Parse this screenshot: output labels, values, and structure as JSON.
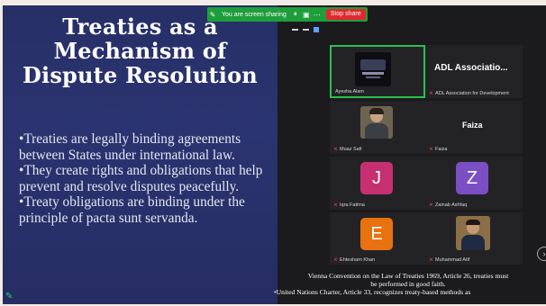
{
  "slide": {
    "title_lines": [
      "Treaties as a",
      "Mechanism of",
      "Dispute Resolution"
    ],
    "bullets": [
      "•Treaties are legally binding agreements between States under international law.",
      "•They create rights and obligations that help prevent and resolve disputes peacefully.",
      "•Treaty obligations are binding under the principle of pacta sunt servanda."
    ]
  },
  "share_bar": {
    "status_text": "You are screen sharing",
    "stop_label": "Stop share"
  },
  "participants": [
    {
      "tile_name": "Ayesha Alam",
      "kind": "video"
    },
    {
      "tile_name": "ADL Association for Development",
      "big_label": "ADL Associatio...",
      "kind": "name"
    },
    {
      "tile_name": "Muaz Safi",
      "kind": "video"
    },
    {
      "tile_name": "Faiza",
      "big_label": "Faiza",
      "kind": "name"
    },
    {
      "tile_name": "Iqra Fatima",
      "initial": "J",
      "color": "#c63071",
      "kind": "avatar"
    },
    {
      "tile_name": "Zainab Ashfaq",
      "initial": "Z",
      "color": "#7b4fc4",
      "kind": "avatar"
    },
    {
      "tile_name": "Ehtesham Khan",
      "initial": "E",
      "color": "#e8720f",
      "kind": "avatar"
    },
    {
      "tile_name": "Muhammad Atif",
      "kind": "video"
    }
  ],
  "caption": {
    "line1": "Vienna Convention on the Law of Treaties 1969, Article 26, treaties must",
    "line2": "be performed in good faith.",
    "line3": "•United Nations Charter, Article 33, recognizes treaty-based methods as"
  },
  "colors": {
    "slide_bg": "#2b3470",
    "share_green": "#1e9e3b",
    "stop_red": "#e0282f",
    "active_border": "#2dbf52"
  }
}
